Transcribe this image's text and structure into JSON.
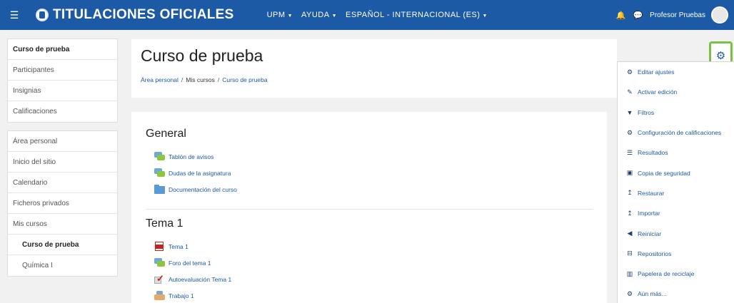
{
  "navbar": {
    "title": "TITULACIONES OFICIALES",
    "menu": [
      "UPM",
      "AYUDA",
      "ESPAÑOL - INTERNACIONAL (ES)"
    ],
    "user_name": "Profesor Pruebas"
  },
  "drawer": {
    "course_block": [
      "Curso de prueba",
      "Participantes",
      "Insignias",
      "Calificaciones"
    ],
    "nav_block": [
      "Área personal",
      "Inicio del sitio",
      "Calendario",
      "Ficheros privados",
      "Mis cursos"
    ],
    "my_courses": [
      "Curso de prueba",
      "Química I"
    ]
  },
  "header": {
    "title": "Curso de prueba",
    "breadcrumb": [
      "Área personal",
      "Mis cursos",
      "Curso de prueba"
    ],
    "breadcrumb_sep": "/"
  },
  "sections": [
    {
      "title": "General",
      "activities": [
        "Tablón de avisos",
        "Dudas de la asignatura",
        "Documentación del curso"
      ]
    },
    {
      "title": "Tema 1",
      "activities": [
        "Tema 1",
        "Foro del tema 1",
        "Autoevaluación Tema 1",
        "Trabajo 1"
      ]
    }
  ],
  "admin_menu": [
    {
      "label": "Editar ajustes",
      "icon": "gear-icon"
    },
    {
      "label": "Activar edición",
      "icon": "pencil-icon"
    },
    {
      "label": "Filtros",
      "icon": "filter-icon"
    },
    {
      "label": "Configuración de calificaciones",
      "icon": "gear-icon"
    },
    {
      "label": "Resultados",
      "icon": "list-icon"
    },
    {
      "label": "Copia de seguridad",
      "icon": "backup-icon"
    },
    {
      "label": "Restaurar",
      "icon": "upload-icon"
    },
    {
      "label": "Importar",
      "icon": "upload-icon"
    },
    {
      "label": "Reiniciar",
      "icon": "arrow-left-icon"
    },
    {
      "label": "Repositorios",
      "icon": "hdd-icon"
    },
    {
      "label": "Papelera de reciclaje",
      "icon": "trash-icon"
    },
    {
      "label": "Aún más...",
      "icon": "gear-icon"
    }
  ],
  "colors": {
    "brand": "#1d5aa5",
    "highlight": "#7ac143"
  }
}
